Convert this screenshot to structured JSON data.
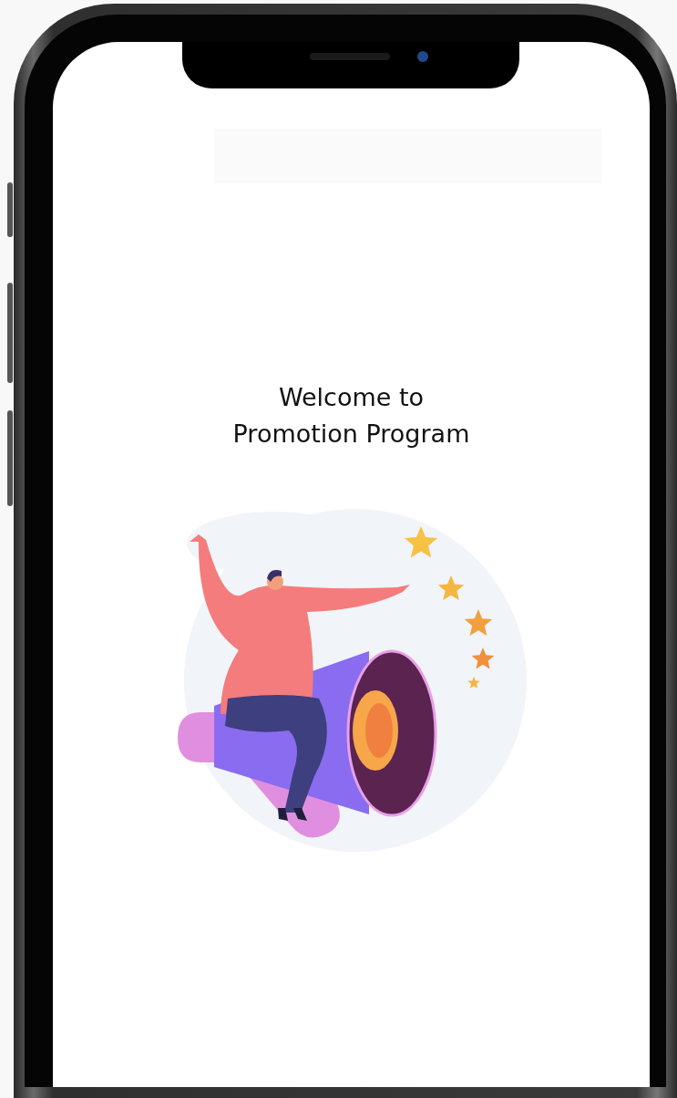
{
  "screen": {
    "title_lines": [
      "Welcome to",
      "Promotion Program"
    ]
  }
}
